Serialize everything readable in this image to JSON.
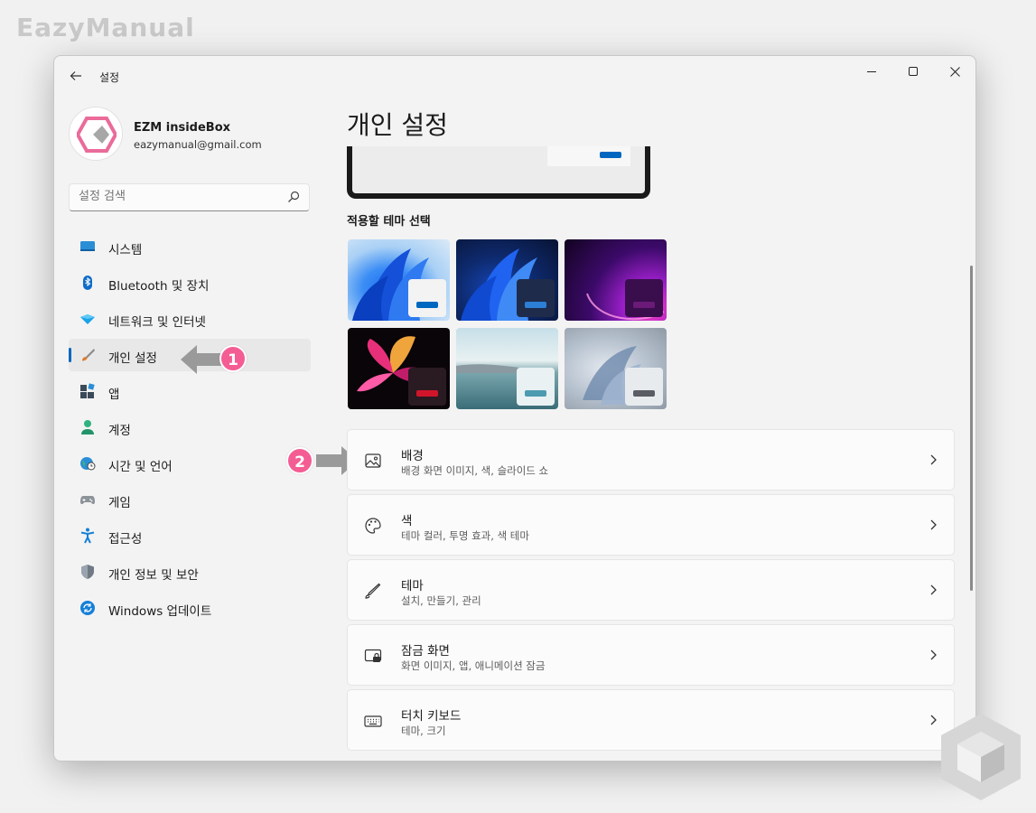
{
  "watermark": {
    "brand": "EazyManual"
  },
  "window": {
    "title": "설정",
    "controls": {
      "minimize": "—",
      "maximize": "☐",
      "close": "✕"
    }
  },
  "profile": {
    "name": "EZM insideBox",
    "email": "eazymanual@gmail.com"
  },
  "search": {
    "placeholder": "설정 검색"
  },
  "sidebar": {
    "items": [
      {
        "label": "시스템",
        "icon": "monitor-icon"
      },
      {
        "label": "Bluetooth 및 장치",
        "icon": "bluetooth-icon"
      },
      {
        "label": "네트워크 및 인터넷",
        "icon": "wifi-diamond-icon"
      },
      {
        "label": "개인 설정",
        "icon": "brush-icon",
        "active": true
      },
      {
        "label": "앱",
        "icon": "apps-icon"
      },
      {
        "label": "계정",
        "icon": "person-icon"
      },
      {
        "label": "시간 및 언어",
        "icon": "globe-clock-icon"
      },
      {
        "label": "게임",
        "icon": "gamepad-icon"
      },
      {
        "label": "접근성",
        "icon": "accessibility-icon"
      },
      {
        "label": "개인 정보 및 보안",
        "icon": "shield-icon"
      },
      {
        "label": "Windows 업데이트",
        "icon": "update-icon"
      }
    ]
  },
  "annotations": {
    "step1": "1",
    "step2": "2"
  },
  "main": {
    "title": "개인 설정",
    "themes_label": "적용할 테마 선택",
    "themes": [
      {
        "name": "windows-light",
        "accent": "#0067c0"
      },
      {
        "name": "windows-dark",
        "accent": "#2b7fd6"
      },
      {
        "name": "glow",
        "accent": "#6b1a78"
      },
      {
        "name": "captured-motion",
        "accent": "#d0152b"
      },
      {
        "name": "sunrise",
        "accent": "#4d9bb0"
      },
      {
        "name": "flow",
        "accent": "#5a5d63"
      }
    ],
    "settings": [
      {
        "title": "배경",
        "subtitle": "배경 화면 이미지, 색, 슬라이드 쇼",
        "icon": "picture-icon"
      },
      {
        "title": "색",
        "subtitle": "테마 컬러, 투명 효과, 색 테마",
        "icon": "palette-icon"
      },
      {
        "title": "테마",
        "subtitle": "설치, 만들기, 관리",
        "icon": "pen-icon"
      },
      {
        "title": "잠금 화면",
        "subtitle": "화면 이미지, 앱, 애니메이션 잠금",
        "icon": "lock-screen-icon"
      },
      {
        "title": "터치 키보드",
        "subtitle": "테마, 크기",
        "icon": "keyboard-icon"
      }
    ]
  },
  "colors": {
    "accent": "#0067c0",
    "badge": "#f45d93",
    "window_bg": "#f3f3f3"
  }
}
